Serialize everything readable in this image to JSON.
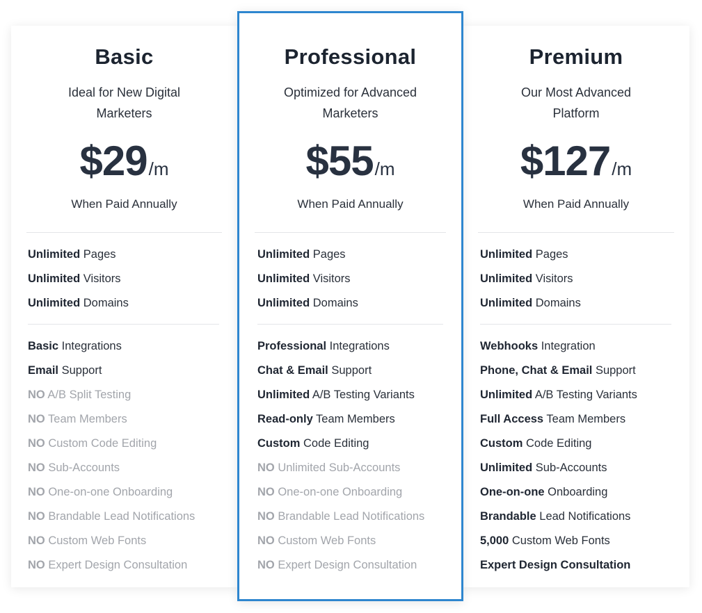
{
  "accent_color": "#2e86cf",
  "plans": [
    {
      "name": "Basic",
      "subtitle_line1": "Ideal for New Digital",
      "subtitle_line2": "Marketers",
      "price": "$29",
      "period": "/m",
      "billing_note": "When Paid Annually",
      "core_features": [
        {
          "bold": "Unlimited",
          "text": " Pages"
        },
        {
          "bold": "Unlimited",
          "text": " Visitors"
        },
        {
          "bold": "Unlimited",
          "text": " Domains"
        }
      ],
      "features": [
        {
          "bold": "Basic",
          "text": " Integrations",
          "included": true
        },
        {
          "bold": "Email",
          "text": " Support",
          "included": true
        },
        {
          "bold": "NO",
          "text": " A/B Split Testing",
          "included": false
        },
        {
          "bold": "NO",
          "text": " Team Members",
          "included": false
        },
        {
          "bold": "NO",
          "text": " Custom Code Editing",
          "included": false
        },
        {
          "bold": "NO",
          "text": " Sub-Accounts",
          "included": false
        },
        {
          "bold": "NO",
          "text": " One-on-one Onboarding",
          "included": false
        },
        {
          "bold": "NO",
          "text": " Brandable Lead Notifications",
          "included": false
        },
        {
          "bold": "NO",
          "text": " Custom Web Fonts",
          "included": false
        },
        {
          "bold": "NO",
          "text": " Expert Design Consultation",
          "included": false
        }
      ]
    },
    {
      "name": "Professional",
      "highlighted": true,
      "subtitle_line1": "Optimized for Advanced",
      "subtitle_line2": "Marketers",
      "price": "$55",
      "period": "/m",
      "billing_note": "When Paid Annually",
      "core_features": [
        {
          "bold": "Unlimited",
          "text": " Pages"
        },
        {
          "bold": "Unlimited",
          "text": " Visitors"
        },
        {
          "bold": "Unlimited",
          "text": " Domains"
        }
      ],
      "features": [
        {
          "bold": "Professional",
          "text": " Integrations",
          "included": true
        },
        {
          "bold": "Chat & Email",
          "text": " Support",
          "included": true
        },
        {
          "bold": "Unlimited",
          "text": " A/B Testing Variants",
          "included": true
        },
        {
          "bold": "Read-only",
          "text": " Team Members",
          "included": true
        },
        {
          "bold": "Custom",
          "text": " Code Editing",
          "included": true
        },
        {
          "bold": "NO",
          "text": " Unlimited Sub-Accounts",
          "included": false
        },
        {
          "bold": "NO",
          "text": " One-on-one Onboarding",
          "included": false
        },
        {
          "bold": "NO",
          "text": " Brandable Lead Notifications",
          "included": false
        },
        {
          "bold": "NO",
          "text": " Custom Web Fonts",
          "included": false
        },
        {
          "bold": "NO",
          "text": " Expert Design Consultation",
          "included": false
        }
      ]
    },
    {
      "name": "Premium",
      "subtitle_line1": "Our Most Advanced",
      "subtitle_line2": "Platform",
      "price": "$127",
      "period": "/m",
      "billing_note": "When Paid Annually",
      "core_features": [
        {
          "bold": "Unlimited",
          "text": " Pages"
        },
        {
          "bold": "Unlimited",
          "text": " Visitors"
        },
        {
          "bold": "Unlimited",
          "text": " Domains"
        }
      ],
      "features": [
        {
          "bold": "Webhooks",
          "text": " Integration",
          "included": true
        },
        {
          "bold": "Phone, Chat & Email",
          "text": " Support",
          "included": true
        },
        {
          "bold": "Unlimited",
          "text": " A/B Testing Variants",
          "included": true
        },
        {
          "bold": "Full Access",
          "text": " Team Members",
          "included": true
        },
        {
          "bold": "Custom",
          "text": " Code Editing",
          "included": true
        },
        {
          "bold": "Unlimited",
          "text": " Sub-Accounts",
          "included": true
        },
        {
          "bold": "One-on-one",
          "text": " Onboarding",
          "included": true
        },
        {
          "bold": "Brandable",
          "text": " Lead Notifications",
          "included": true
        },
        {
          "bold": "5,000",
          "text": " Custom Web Fonts",
          "included": true
        },
        {
          "bold": "Expert Design Consultation",
          "text": "",
          "included": true
        }
      ]
    }
  ]
}
